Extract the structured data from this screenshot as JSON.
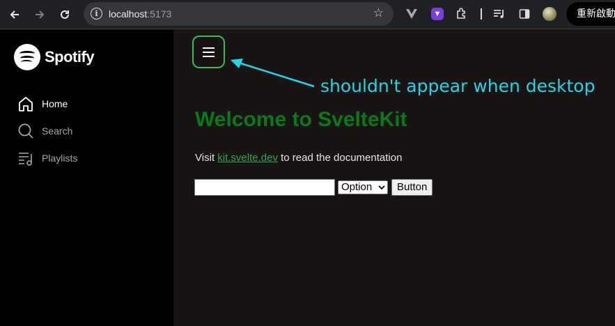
{
  "browser": {
    "url_host": "localhost",
    "url_port": ":5173",
    "restart_label": "重新啟動"
  },
  "sidebar": {
    "brand": "Spotify",
    "items": [
      {
        "label": "Home",
        "icon": "home-icon"
      },
      {
        "label": "Search",
        "icon": "search-icon"
      },
      {
        "label": "Playlists",
        "icon": "playlists-icon"
      }
    ]
  },
  "main": {
    "annotation": "shouldn't appear when desktop",
    "title": "Welcome to SvelteKit",
    "visit_prefix": "Visit ",
    "visit_link": "kit.svelte.dev",
    "visit_suffix": " to read the documentation",
    "select_value": "Option",
    "button_label": "Button"
  },
  "colors": {
    "accent_green": "#2fbf5a",
    "title_green": "#0a7a16",
    "annotation_cyan": "#1fd7e6",
    "main_bg": "#181414",
    "sidebar_bg": "#000000"
  }
}
